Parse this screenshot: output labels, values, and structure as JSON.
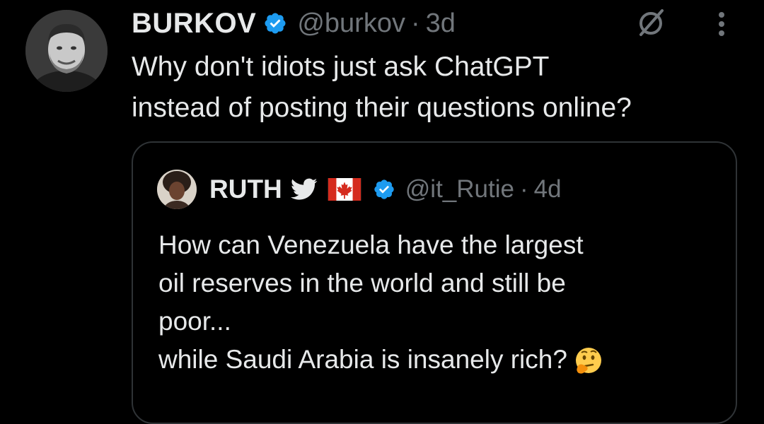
{
  "tweet": {
    "name": "BURKOV",
    "handle": "@burkov",
    "separator": "·",
    "time": "3d",
    "text_lines": [
      "Why don't idiots just ask ChatGPT",
      "instead of posting their questions online?"
    ]
  },
  "quote": {
    "name": "RUTH",
    "handle": "@it_Rutie",
    "separator": "·",
    "time": "4d",
    "name_emoji": [
      "bird-icon",
      "canada-flag-icon"
    ],
    "text_lines": [
      "How can Venezuela have the largest",
      "oil reserves in the world and still be",
      "poor...",
      "while Saudi Arabia is insanely rich?"
    ],
    "trailing_emoji": "thinking-face-icon"
  },
  "colors": {
    "background": "#000000",
    "primary_text": "#e7e9ea",
    "secondary_text": "#71767b",
    "verified_blue": "#1d9bf0",
    "border": "#2f3336"
  }
}
